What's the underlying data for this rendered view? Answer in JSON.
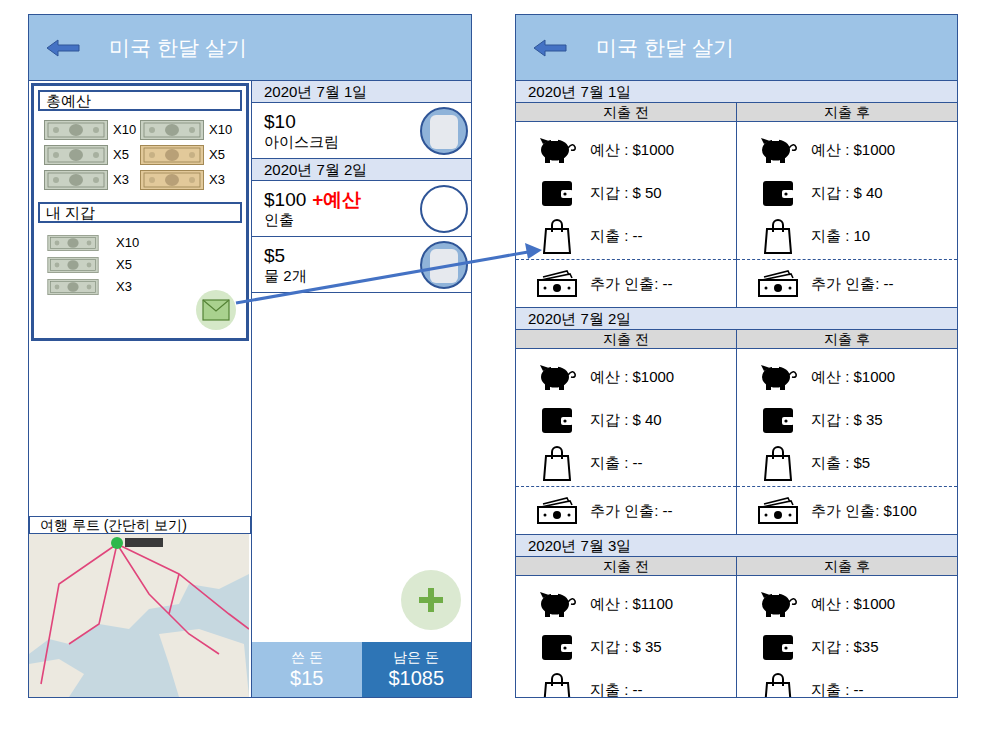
{
  "left": {
    "header": {
      "title": "미국 한달 살기"
    },
    "budget": {
      "title": "총예산",
      "bills": [
        {
          "count": "X10"
        },
        {
          "count": "X10"
        },
        {
          "count": "X5"
        },
        {
          "count": "X5"
        },
        {
          "count": "X3"
        },
        {
          "count": "X3"
        }
      ]
    },
    "wallet": {
      "title": "내 지갑",
      "bills": [
        {
          "count": "X10"
        },
        {
          "count": "X5"
        },
        {
          "count": "X3"
        }
      ]
    },
    "feed": [
      {
        "kind": "date",
        "text": "2020년 7월 1일"
      },
      {
        "kind": "expense",
        "amount": "$10",
        "label": "아이스크림",
        "photo": true
      },
      {
        "kind": "date",
        "text": "2020년 7월 2일"
      },
      {
        "kind": "expense",
        "amount": "$100",
        "badge": "+예산",
        "label": "인출",
        "photo": false
      },
      {
        "kind": "expense",
        "amount": "$5",
        "label": "물 2개",
        "photo": true
      }
    ],
    "route": {
      "label": "여행 루트 (간단히 보기)"
    },
    "totals": [
      {
        "label": "쓴 돈",
        "value": "$15",
        "color": "#9dc3e6"
      },
      {
        "label": "남은 돈",
        "value": "$1085",
        "color": "#2e75b6"
      }
    ]
  },
  "right": {
    "header": {
      "title": "미국 한달 살기"
    },
    "days": [
      {
        "date": "2020년 7월 1일",
        "columns": [
          "지출 전",
          "지출 후"
        ],
        "rows": [
          {
            "kind": "budget",
            "before": "예산 : $1000",
            "after": "예산 : $1000"
          },
          {
            "kind": "wallet",
            "before": "지갑 : $ 50",
            "after": "지갑 : $ 40"
          },
          {
            "kind": "spend",
            "before": "지출 : --",
            "after": "지출 : 10"
          },
          {
            "kind": "extra",
            "before": "추가 인출: --",
            "after": "추가 인출: --"
          }
        ]
      },
      {
        "date": "2020년 7월 2일",
        "columns": [
          "지출 전",
          "지출 후"
        ],
        "rows": [
          {
            "kind": "budget",
            "before": "예산 : $1000",
            "after": "예산 : $1000"
          },
          {
            "kind": "wallet",
            "before": "지갑 : $ 40",
            "after": "지갑 : $ 35"
          },
          {
            "kind": "spend",
            "before": "지출 : --",
            "after": "지출 : $5"
          },
          {
            "kind": "extra",
            "before": "추가 인출: --",
            "after": "추가 인출: $100"
          }
        ]
      },
      {
        "date": "2020년 7월 3일",
        "columns": [
          "지출 전",
          "지출 후"
        ],
        "rows": [
          {
            "kind": "budget",
            "before": "예산 : $1100",
            "after": "예산 : $1000"
          },
          {
            "kind": "wallet",
            "before": "지갑 : $ 35",
            "after": "지갑 : $35"
          },
          {
            "kind": "spend",
            "before": "지출 : --",
            "after": "지출 : --"
          }
        ]
      }
    ]
  }
}
